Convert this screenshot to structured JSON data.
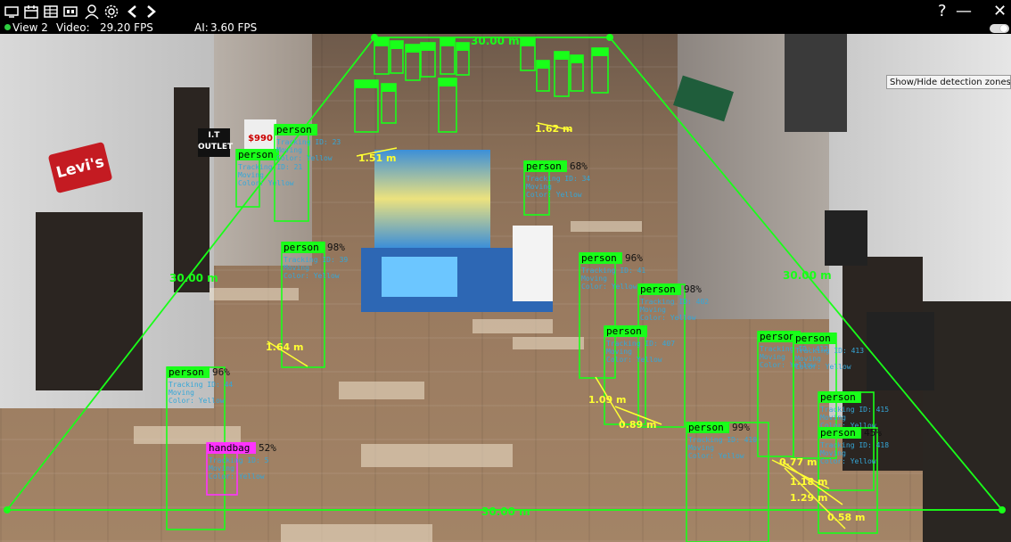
{
  "toolbar": {
    "icons": [
      "monitor-icon",
      "calendar-icon",
      "grid-icon",
      "film-icon",
      "user-icon",
      "gear-icon",
      "back-icon",
      "forward-icon"
    ],
    "view_label": "View 2",
    "video_fps_label": "Video:",
    "video_fps_value": "29.20 FPS",
    "ai_fps_label": "AI:",
    "ai_fps_value": "3.60 FPS",
    "help_label": "?",
    "minimize_label": "—",
    "close_label": "✕"
  },
  "tooltip": {
    "text": "Show/Hide detection zones"
  },
  "zone": {
    "label_top": "30.00 m",
    "label_left": "30.00 m",
    "label_right": "30.00 m",
    "label_bottom": "30.00 m",
    "color": "#19ff19"
  },
  "detections": [
    {
      "name": "person",
      "conf": "68%",
      "info": [
        "Tracking ID: 34",
        "Moving",
        "Color: Yellow"
      ]
    },
    {
      "name": "person",
      "conf": "96%",
      "info": [
        "Tracking ID: 41",
        "Moving",
        "Color: Yellow"
      ]
    },
    {
      "name": "person",
      "conf": "98%",
      "info": [
        "Tracking ID: 39",
        "Moving",
        "Color: Yellow"
      ]
    },
    {
      "name": "person",
      "conf": "96%",
      "info": [
        "Tracking ID: 44",
        "Moving",
        "Color: Yellow"
      ]
    },
    {
      "name": "person",
      "conf": "98%",
      "info": [
        "Tracking ID: 402",
        "Moving",
        "Color: Yellow"
      ]
    },
    {
      "name": "person",
      "conf": "",
      "info": [
        "Tracking ID: 407",
        "Moving",
        "Color: Yellow"
      ]
    },
    {
      "name": "person",
      "conf": "99%",
      "info": [
        "Tracking ID: 410",
        "Moving",
        "Color: Yellow"
      ]
    },
    {
      "name": "person",
      "conf": "",
      "info": [
        "Tracking ID: 412",
        "Moving",
        "Color: Yellow"
      ]
    },
    {
      "name": "person",
      "conf": "",
      "info": [
        "Tracking ID: 413",
        "Moving",
        "Color: Yellow"
      ]
    },
    {
      "name": "person",
      "conf": "",
      "info": [
        "Tracking ID: 415",
        "Moving",
        "Color: Yellow"
      ]
    },
    {
      "name": "person",
      "conf": "45%",
      "info": [
        "Tracking ID: 418",
        "Moving",
        "Color: Yellow"
      ]
    },
    {
      "name": "person",
      "conf": "",
      "info": [
        "Tracking ID: 21",
        "Moving",
        "Color: Yellow"
      ]
    },
    {
      "name": "person",
      "conf": "",
      "info": [
        "Tracking ID: 23",
        "Moving",
        "Color: Yellow"
      ]
    },
    {
      "name": "handbag",
      "conf": "52%",
      "info": [
        "Tracking ID: 5",
        "Moving",
        "Color: Yellow"
      ]
    }
  ],
  "distances": [
    "1.51 m",
    "1.64 m",
    "1.09 m",
    "0.89 m",
    "1.18 m",
    "1.29 m",
    "0.58 m",
    "0.77 m",
    "1.62 m"
  ],
  "store_signs": {
    "levis": "Levi's",
    "it_outlet": "I.T OUTLET",
    "price_tag": "$990"
  }
}
